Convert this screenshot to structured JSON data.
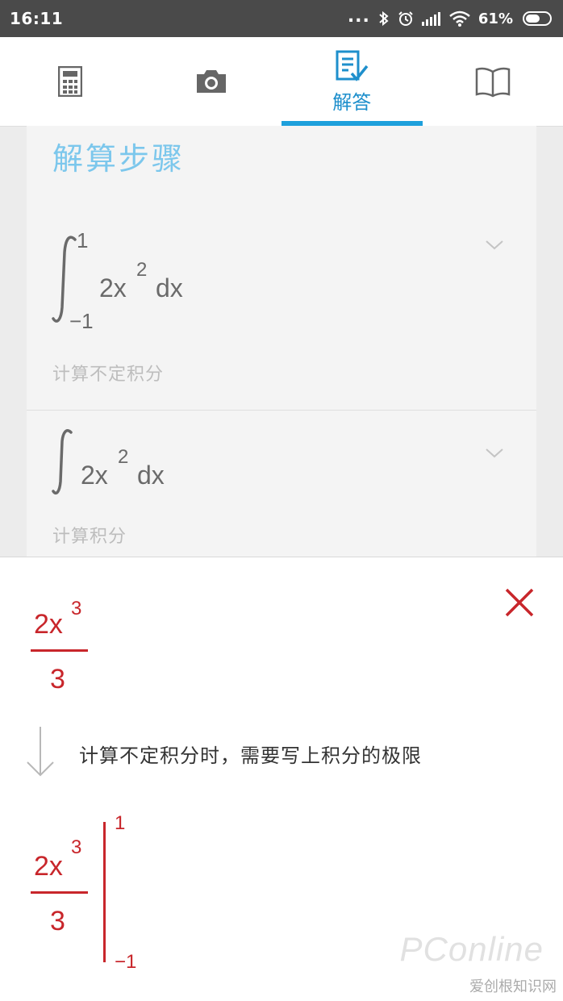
{
  "status_bar": {
    "time": "16:11",
    "dots": "...",
    "battery_percent": "61%",
    "battery_level": 0.61
  },
  "tabs": [
    {
      "name": "calculator",
      "icon": "calculator-icon",
      "label": ""
    },
    {
      "name": "camera",
      "icon": "camera-icon",
      "label": ""
    },
    {
      "name": "solution",
      "icon": "answer-icon",
      "label": "解答",
      "active": true
    },
    {
      "name": "book",
      "icon": "book-icon",
      "label": ""
    }
  ],
  "steps": {
    "title": "解算步骤",
    "items": [
      {
        "expression": {
          "base": "2x",
          "exp": "2",
          "dx": "dx",
          "upper": "1",
          "lower": "−1"
        },
        "description": "计算不定积分"
      },
      {
        "expression": {
          "base": "2x",
          "exp": "2",
          "dx": "dx"
        },
        "description": "计算积分"
      }
    ]
  },
  "detail": {
    "result": {
      "numerator": "2x",
      "exp": "3",
      "denominator": "3"
    },
    "note": "计算不定积分时，需要写上积分的极限",
    "evaluated": {
      "numerator": "2x",
      "exp": "3",
      "denominator": "3",
      "upper": "1",
      "lower": "−1"
    },
    "watermark": "PConline",
    "watermark_sub": "爱创根知识网"
  },
  "colors": {
    "accent": "#1ea0dc",
    "title": "#7cc7ec",
    "math_red": "#c8262b",
    "status_bg": "#4a4a4a"
  }
}
